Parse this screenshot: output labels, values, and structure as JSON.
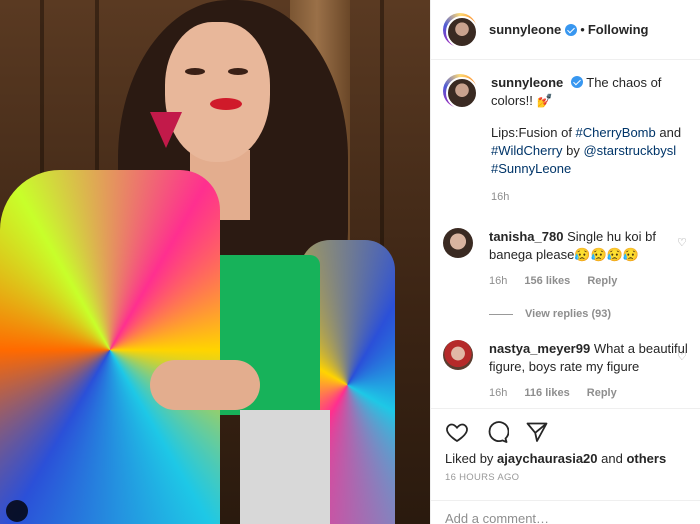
{
  "header": {
    "username": "sunnyleone",
    "separator": "•",
    "follow_status": "Following"
  },
  "caption": {
    "username": "sunnyleone",
    "text": "The chaos of colors!! 💅",
    "line2_prefix": "Lips:Fusion of ",
    "tag1": "#CherryBomb",
    "line2_mid": " and",
    "tag2": "#WildCherry",
    "line3_mid": " by ",
    "mention": "@starstruckbysl",
    "tag3": "#SunnyLeone",
    "time": "16h"
  },
  "comments": [
    {
      "username": "tanisha_780",
      "text": "Single hu koi bf banega please😥😥😥😥",
      "time": "16h",
      "likes": "156 likes",
      "reply": "Reply",
      "view_replies": "View replies (93)"
    },
    {
      "username": "nastya_meyer99",
      "text": "What a beautiful figure, boys rate my figure",
      "time": "16h",
      "likes": "116 likes",
      "reply": "Reply"
    }
  ],
  "footer": {
    "liked_by_prefix": "Liked by ",
    "liked_by_user": "ajaychaurasia20",
    "liked_by_mid": " and ",
    "liked_by_others": "others",
    "timestamp": "16 HOURS AGO",
    "add_comment_placeholder": "Add a comment…"
  }
}
